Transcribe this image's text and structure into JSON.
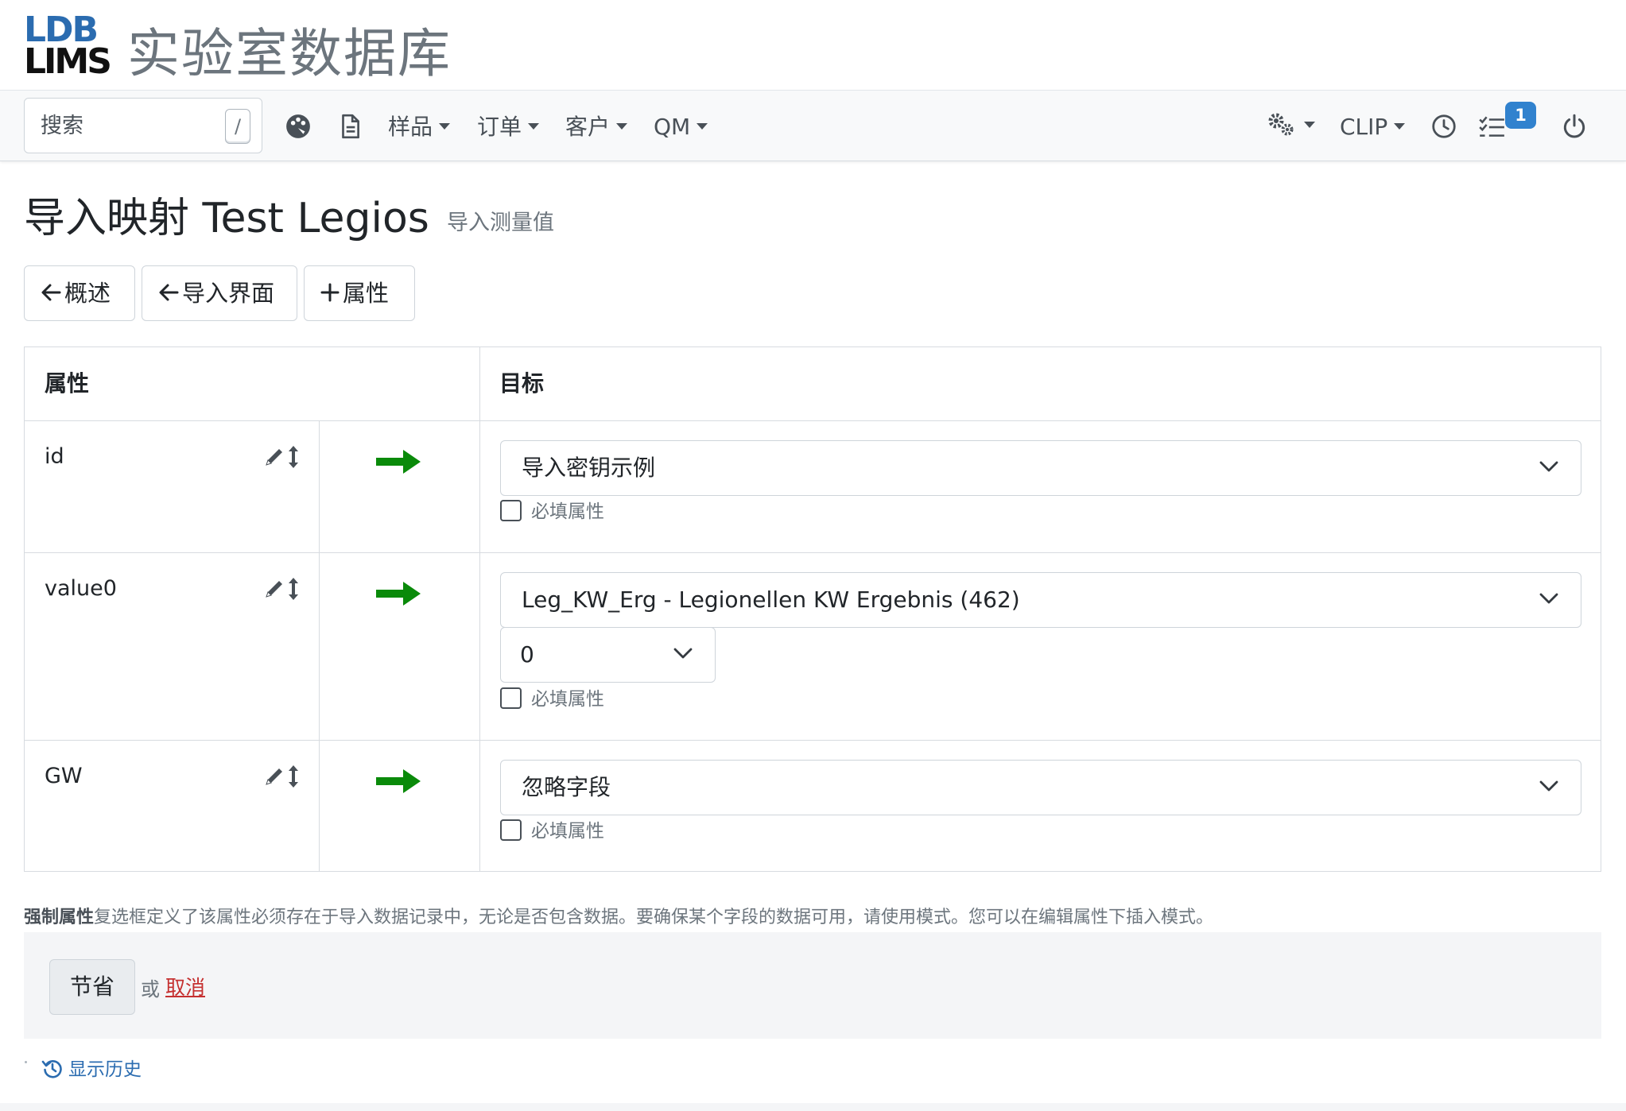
{
  "brand": {
    "logo_line1": "LDB",
    "logo_line2": "LIMS",
    "app_title": "实验室数据库",
    "logo_blue": "#2b6cb0"
  },
  "navbar": {
    "search_placeholder": "搜索",
    "search_shortcut": "/",
    "icons": [
      "palette-icon",
      "document-icon",
      "gears-icon",
      "clock-icon",
      "tasks-icon",
      "power-icon"
    ],
    "menus": {
      "samples": "样品",
      "orders": "订单",
      "customers": "客户",
      "qm": "QM",
      "clip": "CLIP"
    },
    "tasks_badge": "1",
    "badge_color": "#3182ce"
  },
  "page": {
    "title": "导入映射 Test Legios",
    "subtitle": "导入测量值"
  },
  "actions": {
    "overview": "概述",
    "import_interface": "导入界面",
    "add_property": "属性"
  },
  "table": {
    "headers": {
      "property": "属性",
      "target": "目标"
    },
    "rows": [
      {
        "property": "id",
        "target": "导入密钥示例",
        "required_label": "必填属性",
        "required": false
      },
      {
        "property": "value0",
        "target": "Leg_KW_Erg - Legionellen KW Ergebnis (462)",
        "sub_select": "0",
        "required_label": "必填属性",
        "required": false
      },
      {
        "property": "GW",
        "target": "忽略字段",
        "required_label": "必填属性",
        "required": false
      }
    ],
    "arrow_color": "#0a8a0a"
  },
  "footer": {
    "help_bold": "强制属性",
    "help_text": "复选框定义了该属性必须存在于导入数据记录中，无论是否包含数据。要确保某个字段的数据可用，请使用模式。您可以在编辑属性下插入模式。",
    "save": "节省",
    "or": "或",
    "cancel": "取消",
    "show_history": "显示历史",
    "cancel_color": "#c53030"
  }
}
